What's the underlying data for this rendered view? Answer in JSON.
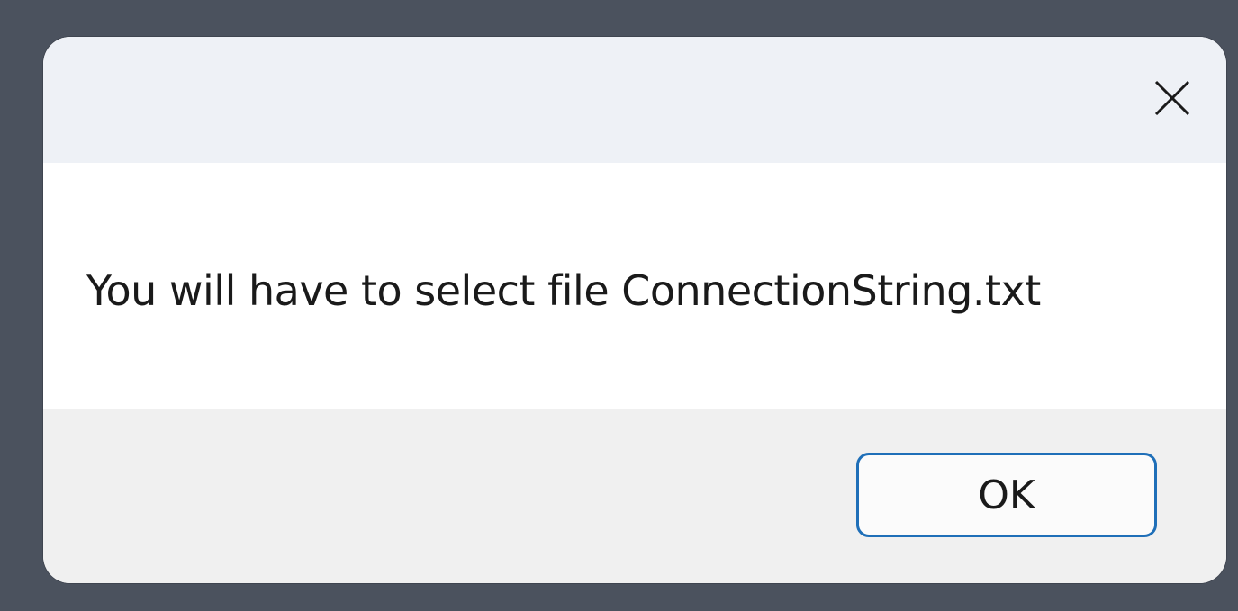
{
  "dialog": {
    "message": "You will have to select file ConnectionString.txt",
    "ok_label": "OK",
    "close_icon": "close-icon"
  },
  "colors": {
    "backdrop": "#4b525e",
    "titlebar": "#eef1f6",
    "content": "#ffffff",
    "footer": "#f0f0f0",
    "button_border": "#1f6fb8"
  }
}
